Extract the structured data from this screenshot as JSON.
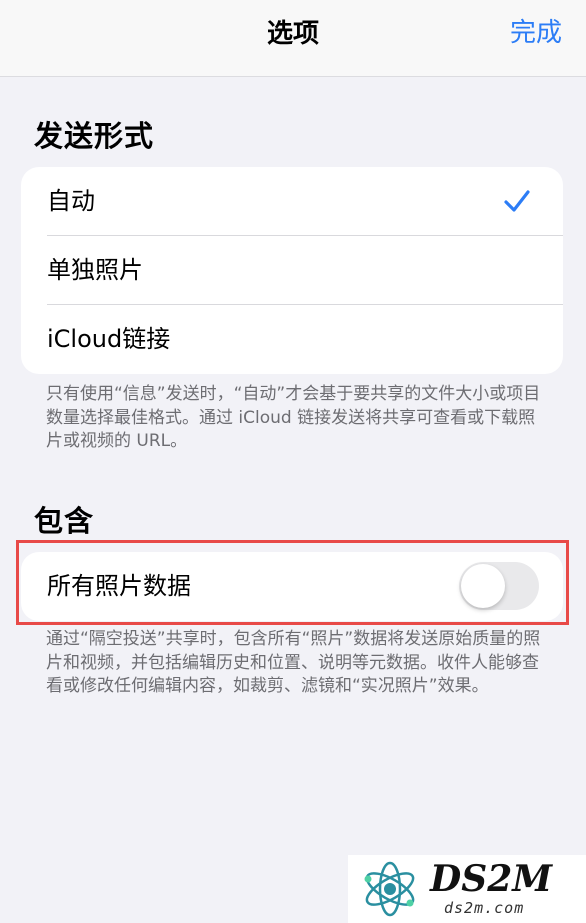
{
  "nav": {
    "title": "选项",
    "done_label": "完成",
    "accent_color": "#2c7df6"
  },
  "send_format": {
    "header": "发送形式",
    "options": [
      {
        "label": "自动",
        "selected": true
      },
      {
        "label": "单独照片",
        "selected": false
      },
      {
        "label": "iCloud链接",
        "selected": false
      }
    ],
    "footer": "只有使用“信息”发送时，“自动”才会基于要共享的文件大小或项目数量选择最佳格式。通过 iCloud 链接发送将共享可查看或下载照片或视频的 URL。"
  },
  "include": {
    "header": "包含",
    "all_photos_data_label": "所有照片数据",
    "all_photos_data_enabled": false,
    "footer": "通过“隔空投送”共享时，包含所有“照片”数据将发送原始质量的照片和视频，并包括编辑历史和位置、说明等元数据。收件人能够查看或修改任何编辑内容，如裁剪、滤镜和“实况照片”效果。"
  },
  "annotation": {
    "highlight_color": "#e84a48"
  },
  "watermark": {
    "title": "DS2M",
    "subtitle": "ds2m.com"
  }
}
